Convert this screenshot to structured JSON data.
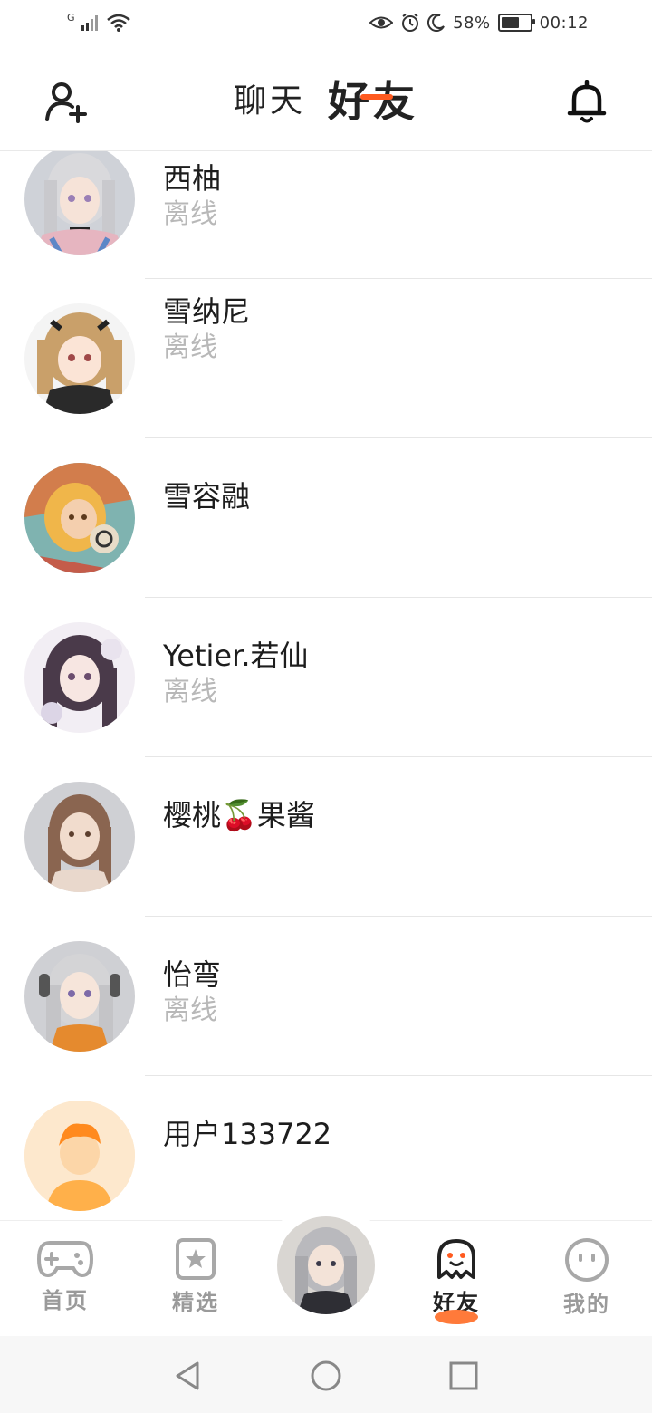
{
  "status_bar": {
    "network": "G",
    "battery_percent": "58%",
    "time": "00:12",
    "icons": [
      "signal-icon",
      "wifi-icon",
      "eye-icon",
      "alarm-icon",
      "moon-icon",
      "battery-icon"
    ]
  },
  "header": {
    "tabs": [
      {
        "label": "聊天",
        "active": false
      },
      {
        "label": "好友",
        "active": true
      }
    ],
    "left_icon": "add-user-icon",
    "right_icon": "bell-icon",
    "accent": "#ff5a1f"
  },
  "friends": [
    {
      "name": "西柚",
      "status": "离线"
    },
    {
      "name": "雪纳尼",
      "status": "离线"
    },
    {
      "name": "雪容融",
      "status": ""
    },
    {
      "name": "Yetier.若仙",
      "status": "离线"
    },
    {
      "name": "樱桃🍒果酱",
      "status": ""
    },
    {
      "name": "怡弯",
      "status": "离线"
    },
    {
      "name": "用户133722",
      "status": ""
    }
  ],
  "bottom_nav": {
    "items": [
      {
        "label": "首页",
        "icon": "gamepad-icon",
        "active": false
      },
      {
        "label": "精选",
        "icon": "star-icon",
        "active": false
      },
      {
        "label": "好友",
        "icon": "ghost-icon",
        "active": true
      },
      {
        "label": "我的",
        "icon": "face-icon",
        "active": false
      }
    ],
    "center_icon": "profile-avatar",
    "active_color": "#ff7a3a"
  },
  "system_nav": {
    "icons": [
      "back-icon",
      "home-icon",
      "recents-icon"
    ]
  }
}
